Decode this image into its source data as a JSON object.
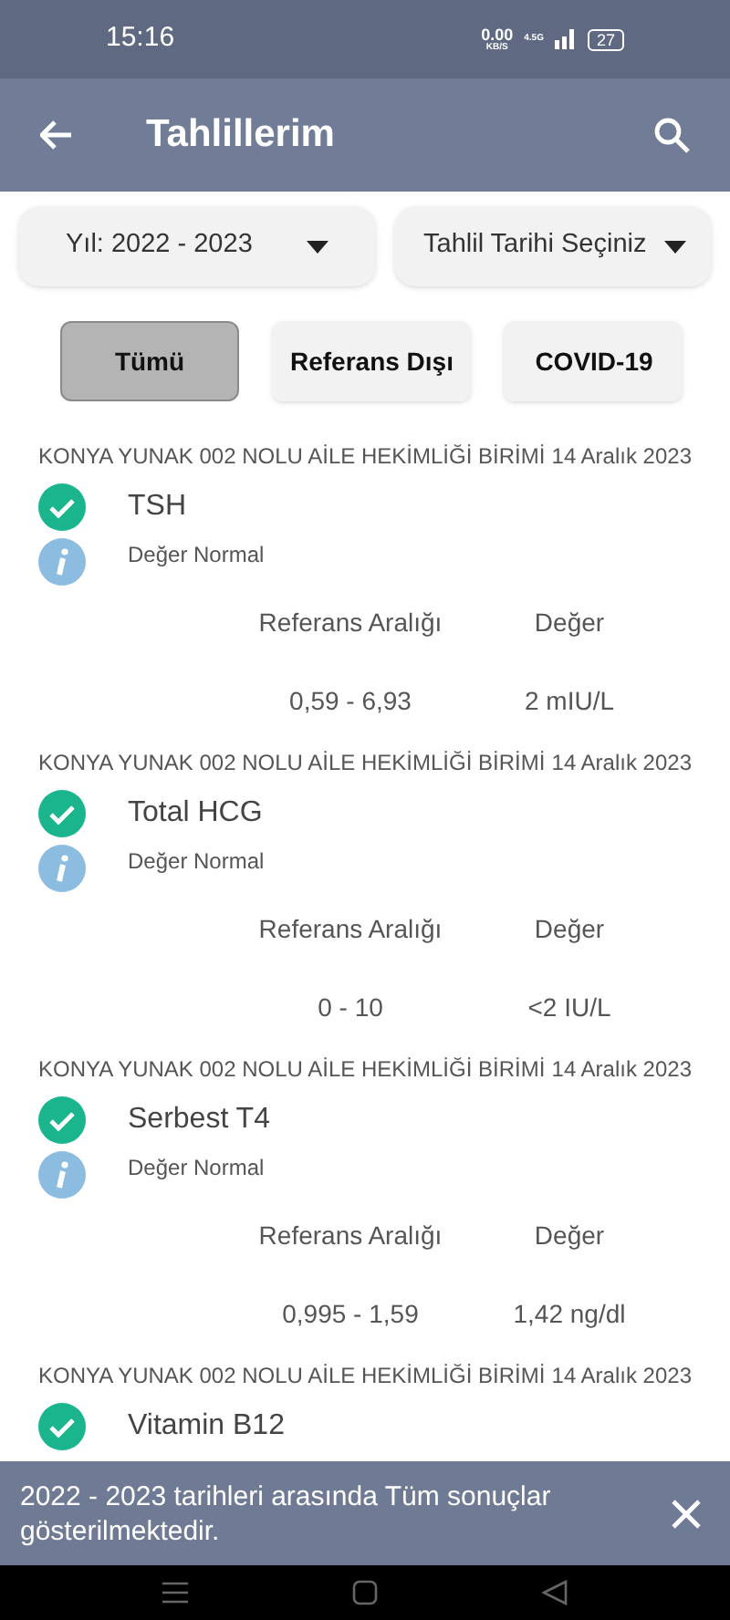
{
  "status_bar": {
    "time": "15:16",
    "speed": "0.00",
    "speed_unit": "KB/S",
    "network": "4.5G",
    "battery": "27"
  },
  "app_bar": {
    "title": "Tahlillerim"
  },
  "filters": {
    "year": "Yıl: 2022 - 2023",
    "date": "Tahlil Tarihi Seçiniz"
  },
  "segments": [
    {
      "label": "Tümü",
      "selected": true
    },
    {
      "label": "Referans Dışı",
      "selected": false
    },
    {
      "label": "COVID-19",
      "selected": false
    }
  ],
  "results": [
    {
      "institution": "KONYA YUNAK 002 NOLU AİLE HEKİMLİĞİ BİRİMİ",
      "date": "14 Aralık 2023",
      "test": "TSH",
      "status": "Değer Normal",
      "range_label": "Referans Aralığı",
      "value_label": "Değer",
      "range": "0,59 - 6,93",
      "value": "2 mIU/L"
    },
    {
      "institution": "KONYA YUNAK 002 NOLU AİLE HEKİMLİĞİ BİRİMİ",
      "date": "14 Aralık 2023",
      "test": "Total HCG",
      "status": "Değer Normal",
      "range_label": "Referans Aralığı",
      "value_label": "Değer",
      "range": "0 - 10",
      "value": "<2 IU/L"
    },
    {
      "institution": "KONYA YUNAK 002 NOLU AİLE HEKİMLİĞİ BİRİMİ",
      "date": "14 Aralık 2023",
      "test": "Serbest T4",
      "status": "Değer Normal",
      "range_label": "Referans Aralığı",
      "value_label": "Değer",
      "range": "0,995 - 1,59",
      "value": "1,42 ng/dl"
    },
    {
      "institution": "KONYA YUNAK 002 NOLU AİLE HEKİMLİĞİ BİRİMİ",
      "date": "14 Aralık 2023",
      "test": "Vitamin B12"
    }
  ],
  "snackbar": {
    "message": "2022 - 2023 tarihleri arasında Tüm sonuçlar gösterilmektedir."
  }
}
